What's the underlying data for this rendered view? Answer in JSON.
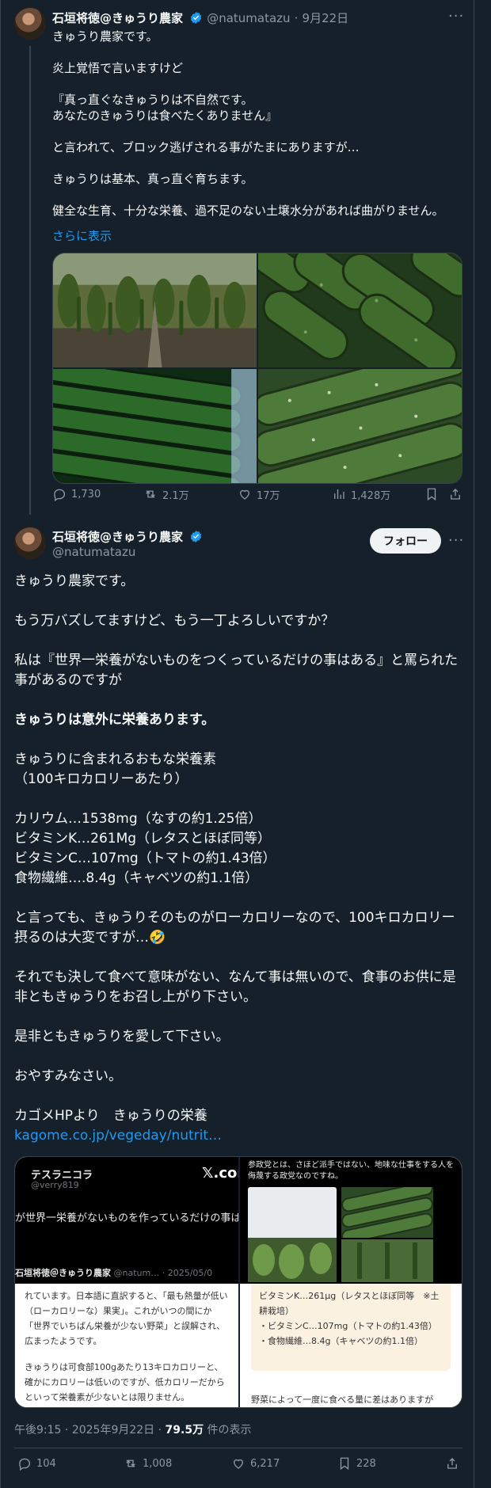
{
  "tweet1": {
    "author_name": "石垣将徳@きゅうり農家",
    "handle": "@natumatazu",
    "separator": "·",
    "date": "9月22日",
    "paragraphs": [
      "きゅうり農家です。",
      "炎上覚悟で言いますけど",
      "『真っ直ぐなきゅうりは不自然です。\nあなたのきゅうりは食べたくありません』",
      "と言われて、ブロック逃げされる事がたまにありますが…",
      "きゅうりは基本、真っ直ぐ育ちます。",
      "健全な生育、十分な栄養、過不足のない土壌水分があれば曲がりません。"
    ],
    "show_more": "さらに表示",
    "replies": "1,730",
    "retweets": "2.1万",
    "likes": "17万",
    "views": "1,428万"
  },
  "tweet2": {
    "author_name": "石垣将徳@きゅうり農家",
    "handle": "@natumatazu",
    "follow_label": "フォロー",
    "p1": "きゅうり農家です。",
    "p2": "もう万バズしてますけど、もう一丁よろしいですか？",
    "p3": "私は『世界一栄養がないものをつくっているだけの事はある』と罵られた事があるのですが",
    "p4_bold": "きゅうりは意外に栄養あります。",
    "p5": "きゅうりに含まれるおもな栄養素\n（100キロカロリーあたり）",
    "p6": "カリウム…1538mg（なすの約1.25倍）\nビタミンK…261Mg（レタスとほぼ同等）\nビタミンC…107mg（トマトの約1.43倍）\n食物繊維….8.4g（キャベツの約1.1倍）",
    "p7": "と言っても、きゅうりそのものがローカロリーなので、100キロカロリー摂るのは大変ですが…🤣",
    "p8": "それでも決して食べて意味がない、なんて事は無いので、食事のお供に是非ともきゅうりをお召し上がり下さい。",
    "p9": "是非ともきゅうりを愛して下さい。",
    "p10": "おやすみなさい。",
    "p11": "カゴメHPより　きゅうりの栄養",
    "link": "kagome.co.jp/vegeday/nutrit…",
    "time": "午後9:15",
    "date": "2025年9月22日",
    "views_count": "79.5万",
    "views_label": "件の表示",
    "replies": "104",
    "retweets": "1,008",
    "likes": "6,217",
    "bookmarks": "228"
  },
  "card": {
    "left_name": "テスラニコラ",
    "left_handle": "@verry819",
    "left_x_logo": "𝕏.com",
    "left_quote": "が世界一栄養がないものを作っているだけの事は",
    "left_footer_name": "石垣将徳＠きゅうり農家",
    "left_footer_meta": "@natum… · 2025/05/0",
    "left_body": "れています。日本語に直訳すると、「最も熱量が低い（ローカロリーな）果実」。これがいつの間にか「世界でいちばん栄養が少ない野菜」と誤解され、広まったようです。",
    "left_body2": "きゅうりは可食部100gあたり13キロカロリーと、確かにカロリーは低いのですが、低カロリーだからといって栄養素が少ないとは限りません。",
    "right_title": "参政党とは、さほど派手ではない、地味な仕事をする人を侮蔑する政党なのですね。",
    "right_box1": "ビタミンK…261μg（レタスとほぼ同等　※土耕栽培）",
    "right_box2": "ビタミンC…107mg（トマトの約1.43倍）",
    "right_box3": "食物繊維…8.4g（キャベツの約1.1倍）",
    "right_footer": "野菜によって一度に食べる量に差はありますが"
  },
  "colors": {
    "background": "#15202b",
    "text": "#f7f9f9",
    "muted": "#8b98a5",
    "link": "#1d9bf0",
    "border": "#38444d"
  }
}
